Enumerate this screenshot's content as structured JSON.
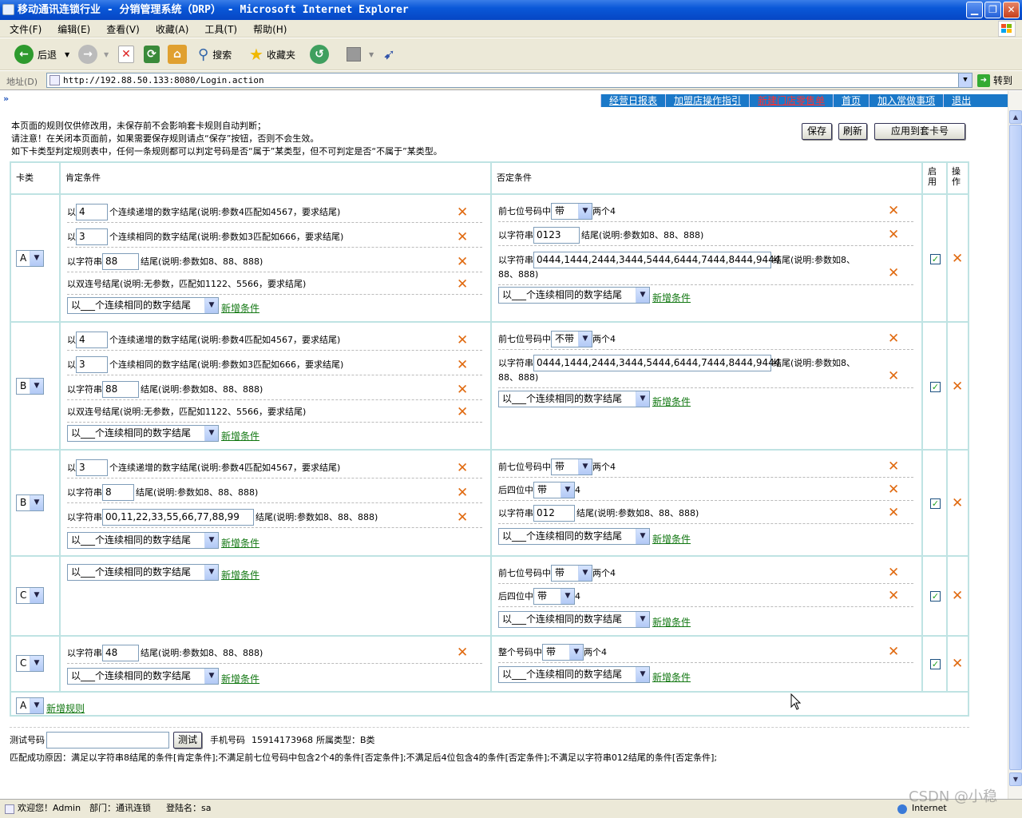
{
  "window": {
    "title": "移动通讯连锁行业 - 分销管理系统（DRP） - Microsoft Internet Explorer"
  },
  "menu": [
    "文件(F)",
    "编辑(E)",
    "查看(V)",
    "收藏(A)",
    "工具(T)",
    "帮助(H)"
  ],
  "toolbar": {
    "back": "后退",
    "search": "搜索",
    "favorites": "收藏夹"
  },
  "address": {
    "label": "地址(D)",
    "url": "http://192.88.50.133:8080/Login.action",
    "go": "转到"
  },
  "nav": {
    "links": [
      "经营日报表",
      "加盟店操作指引",
      "新建门店零售单",
      "首页",
      "加入常做事项",
      "退出"
    ]
  },
  "notes": [
    "本页面的规则仅供修改用，未保存前不会影响套卡规则自动判断；",
    "请注意！在关闭本页面前，如果需要保存规则请点“保存”按钮，否则不会生效。",
    "如下卡类型判定规则表中，任何一条规则都可以判定号码是否“属于”某类型，但不可判定是否“不属于”某类型。"
  ],
  "buttons": {
    "save": "保存",
    "refresh": "刷新",
    "apply": "应用到套卡号",
    "test": "测试"
  },
  "headers": {
    "type": "卡类",
    "pos": "肯定条件",
    "neg": "否定条件",
    "enable": "启用",
    "op": "操作"
  },
  "texts": {
    "yi": "以",
    "inc_desc": "个连续递增的数字结尾(说明:参数4匹配如4567，要求结尾)",
    "same_desc": "个连续相同的数字结尾(说明:参数如3匹配如666，要求结尾)",
    "str_prefix": "以字符串",
    "str_desc": "结尾(说明:参数如8、88、888)",
    "str_desc_a": "结尾(说明:参数如8、",
    "str_desc_b": "88、888)",
    "pair_desc": "以双连号结尾(说明:无参数，匹配如1122、5566，要求结尾)",
    "first7": "前七位号码中",
    "two4": "两个4",
    "last4": "后四位中",
    "four": "4",
    "whole": "整个号码中",
    "dropdown": "以___个连续相同的数字结尾",
    "add_cond": "新增条件",
    "add_rule": "新增规则"
  },
  "rules": [
    {
      "type": "A",
      "inc": "4",
      "same": "3",
      "str": "88",
      "neg_sel": "带",
      "neg_str": "0123",
      "neg_str2": "0444,1444,2444,3444,5444,6444,7444,8444,9444"
    },
    {
      "type": "B",
      "inc": "4",
      "same": "3",
      "str": "88",
      "neg_sel": "不带",
      "neg_str2": "0444,1444,2444,3444,5444,6444,7444,8444,9444"
    },
    {
      "type": "B",
      "inc": "3",
      "str": "8",
      "str2": "00,11,22,33,55,66,77,88,99",
      "neg_sel": "带",
      "last4_sel": "带",
      "neg_str": "012"
    },
    {
      "type": "C",
      "neg_sel": "带",
      "last4_sel": "带"
    },
    {
      "type": "C",
      "str": "48",
      "whole_sel": "带"
    }
  ],
  "new_rule_type": "A",
  "test": {
    "label": "测试号码",
    "input": "",
    "phone_label": "手机号码",
    "phone": "15914173968",
    "type_label": "所属类型：",
    "type": "B类"
  },
  "match": "匹配成功原因：满足以字符串8结尾的条件[肯定条件];不满足前七位号码中包含2个4的条件[否定条件];不满足后4位包含4的条件[否定条件];不满足以字符串012结尾的条件[否定条件];",
  "status": {
    "welcome": "欢迎您！Admin",
    "dept": "部门：通讯连锁",
    "login": "登陆名：sa",
    "zone": "Internet",
    "watermark": "CSDN @小稳"
  },
  "colors": {
    "title": "#0a58d8",
    "nav": "#1a78c8",
    "border": "#bfe3e3",
    "delete": "#e06a10",
    "link": "#117711"
  }
}
